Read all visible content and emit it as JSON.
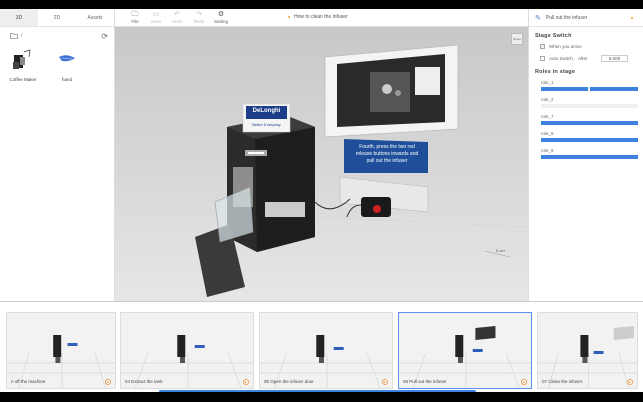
{
  "left_panel": {
    "tabs": [
      "3D",
      "2D",
      "Assets"
    ],
    "path": "/",
    "assets": [
      {
        "label": "Coffee Maker",
        "icon": "coffee-maker-icon"
      },
      {
        "label": "hand",
        "icon": "hand-icon"
      }
    ]
  },
  "toolbar": {
    "file": "File",
    "save": "Save",
    "undo": "Undo",
    "redo": "Redo",
    "setting": "Setting",
    "stage_title": "How to clean the infuser"
  },
  "viewport": {
    "brand_main": "DeLonghi",
    "brand_sub": "Better Everyday",
    "callout_line1": "Fourth, press the two red",
    "callout_line2": "release buttons inwards and",
    "callout_line3": "pull out the infuser",
    "reset_label": "Reset",
    "scale_label": "5 cm"
  },
  "right_panel": {
    "stage_name": "Pull out the infuser",
    "stage_switch_title": "Stage Switch",
    "when_arrive": "When you arrive",
    "auto_switch": "Auto Switch,",
    "after": "After",
    "after_value": "5.000",
    "roles_title": "Roles in stage",
    "roles": [
      {
        "name": "role_1",
        "fill": 1.0
      },
      {
        "name": "role_2",
        "fill": 0.0
      },
      {
        "name": "role_7",
        "fill": 1.0
      },
      {
        "name": "role_8",
        "fill": 1.0
      },
      {
        "name": "role_9",
        "fill": 1.0
      }
    ]
  },
  "timeline": {
    "frames": [
      {
        "caption": "n off the machine",
        "active": false
      },
      {
        "caption": "04  Extract the tank",
        "active": false
      },
      {
        "caption": "05  Open the infuser door",
        "active": false
      },
      {
        "caption": "06  Pull out the infuser",
        "active": true
      },
      {
        "caption": "07  Clean the infuser",
        "active": false
      }
    ]
  },
  "colors": {
    "accent": "#3e82e0",
    "orange": "#f0a030",
    "callout": "#1f4f9a"
  }
}
